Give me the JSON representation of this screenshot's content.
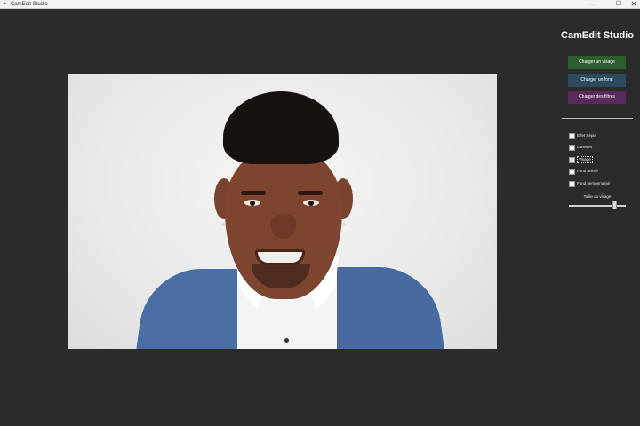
{
  "window": {
    "title": "CamEdit Studio",
    "app_icon": "camera-icon",
    "minimize_glyph": "—",
    "maximize_glyph": "☐",
    "close_glyph": "✕"
  },
  "panel": {
    "app_title": "CamEdit Studio",
    "buttons": {
      "load_face": "Charger un visage",
      "load_background": "Charger un fond",
      "load_filters": "Charger des filtres"
    },
    "options": [
      {
        "label": "Effet Sépia",
        "checked": false
      },
      {
        "label": "Lunettes",
        "checked": false
      },
      {
        "label": "Visage",
        "checked": true
      },
      {
        "label": "Fond animé",
        "checked": false
      },
      {
        "label": "Fond personnalisé",
        "checked": false
      }
    ],
    "slider": {
      "label": "Taille du visage",
      "value_fraction": 0.8
    }
  },
  "colors": {
    "background": "#2b2b2b",
    "face_button": "#2d5f2e",
    "background_button": "#2e4a5e",
    "filters_button": "#5a2a5c"
  },
  "check_glyph": "✓"
}
